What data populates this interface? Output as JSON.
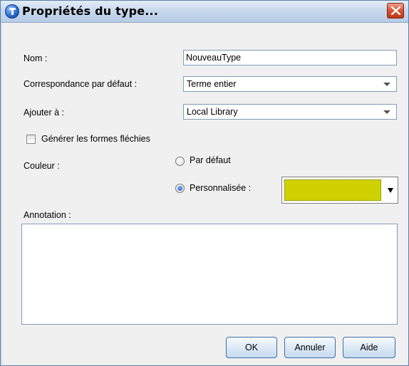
{
  "window": {
    "title": "Propriétés du type...",
    "icon": "info-icon",
    "close_icon": "close-icon"
  },
  "form": {
    "name_label": "Nom :",
    "name_value": "NouveauType",
    "match_label": "Correspondance par défaut :",
    "match_value": "Terme entier",
    "add_to_label": "Ajouter à :",
    "add_to_value": "Local Library",
    "inflected_label": "Générer les formes fléchies",
    "inflected_checked": false,
    "color_label": "Couleur :",
    "color_default_label": "Par défaut",
    "color_custom_label": "Personnalisée :",
    "color_selected": "custom",
    "custom_color": "#cfd200",
    "annotation_label": "Annotation :",
    "annotation_value": ""
  },
  "buttons": {
    "ok": "OK",
    "cancel": "Annuler",
    "help": "Aide"
  }
}
